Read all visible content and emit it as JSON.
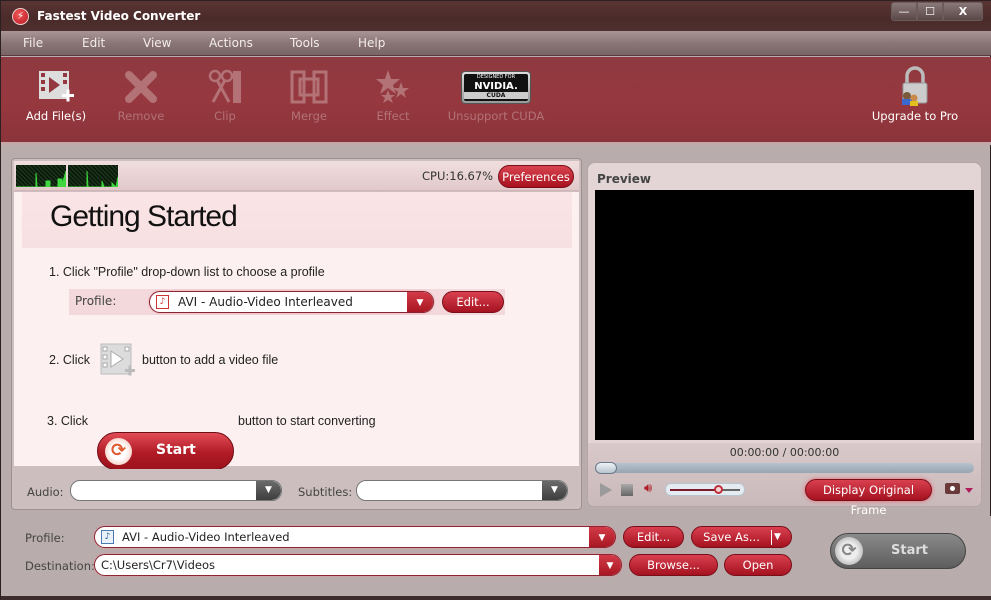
{
  "window": {
    "title": "Fastest Video Converter",
    "controls": {
      "minimize": "—",
      "maximize": "☐",
      "close": "X"
    }
  },
  "menu": [
    "File",
    "Edit",
    "View",
    "Actions",
    "Tools",
    "Help"
  ],
  "toolbar": {
    "items": [
      {
        "label": "Add File(s)",
        "icon": "add-file-icon",
        "enabled": true
      },
      {
        "label": "Remove",
        "icon": "remove-icon",
        "enabled": false
      },
      {
        "label": "Clip",
        "icon": "clip-icon",
        "enabled": false
      },
      {
        "label": "Merge",
        "icon": "merge-icon",
        "enabled": false
      },
      {
        "label": "Effect",
        "icon": "effect-icon",
        "enabled": false
      },
      {
        "label": "Unsupport CUDA",
        "icon": "nvidia-cuda-icon",
        "enabled": false
      }
    ],
    "cuda_badge": {
      "line1": "DESIGNED FOR",
      "line2": "NVIDIA.",
      "line3": "CUDA"
    },
    "upgrade_label": "Upgrade to Pro"
  },
  "left_panel": {
    "cpu": "CPU:16.67%",
    "preferences": "Preferences",
    "heading": "Getting Started",
    "step1": "1. Click \"Profile\" drop-down list to choose a profile",
    "profile_label": "Profile:",
    "profile_value": "AVI - Audio-Video Interleaved",
    "edit_button": "Edit...",
    "step2_prefix": "2. Click",
    "step2_suffix": "button to add a video file",
    "step3_prefix": "3. Click",
    "step3_button": "Start",
    "step3_suffix": "button to start converting",
    "audio_label": "Audio:",
    "audio_value": "",
    "subtitles_label": "Subtitles:",
    "subtitles_value": ""
  },
  "preview": {
    "label": "Preview",
    "time": "00:00:00 / 00:00:00",
    "seek_progress": 0,
    "volume_level": 0.7,
    "display_original_frame": "Display Original Frame"
  },
  "bottom": {
    "profile_label": "Profile:",
    "profile_value": "AVI - Audio-Video Interleaved",
    "destination_label": "Destination:",
    "destination_value": "C:\\Users\\Cr7\\Videos",
    "edit_button": "Edit...",
    "save_as_button": "Save As...",
    "browse_button": "Browse...",
    "open_button": "Open",
    "start_button": "Start"
  },
  "colors": {
    "accent": "#b01c26",
    "toolbar": "#93383f",
    "titlebar": "#4e2f2e"
  }
}
